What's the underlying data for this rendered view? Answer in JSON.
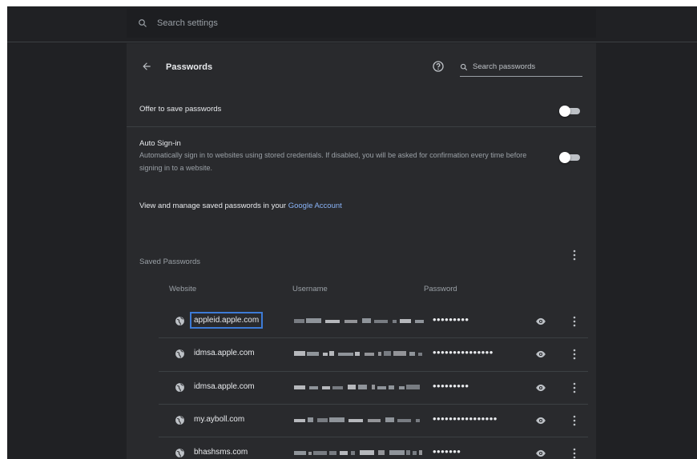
{
  "search": {
    "placeholder": "Search settings"
  },
  "header": {
    "title": "Passwords",
    "search_placeholder": "Search passwords"
  },
  "offer": {
    "label": "Offer to save passwords",
    "enabled": false
  },
  "auto_signin": {
    "label": "Auto Sign-in",
    "description": "Automatically sign in to websites using stored credentials. If disabled, you will be asked for confirmation every time before signing in to a website.",
    "enabled": false
  },
  "manage": {
    "prefix": "View and manage saved passwords in your ",
    "link": "Google Account"
  },
  "saved": {
    "title": "Saved Passwords",
    "columns": {
      "website": "Website",
      "username": "Username",
      "password": "Password"
    },
    "rows": [
      {
        "site": "appleid.apple.com",
        "password": "•••••••••",
        "focused": true
      },
      {
        "site": "idmsa.apple.com",
        "password": "•••••••••••••••"
      },
      {
        "site": "idmsa.apple.com",
        "password": "•••••••••"
      },
      {
        "site": "my.ayboll.com",
        "password": "••••••••••••••••"
      },
      {
        "site": "bhashsms.com",
        "password": "•••••••"
      }
    ]
  },
  "colors": {
    "background": "#202124",
    "card": "#292a2d",
    "link": "#8ab4f8",
    "focus": "#3d7bd6"
  }
}
